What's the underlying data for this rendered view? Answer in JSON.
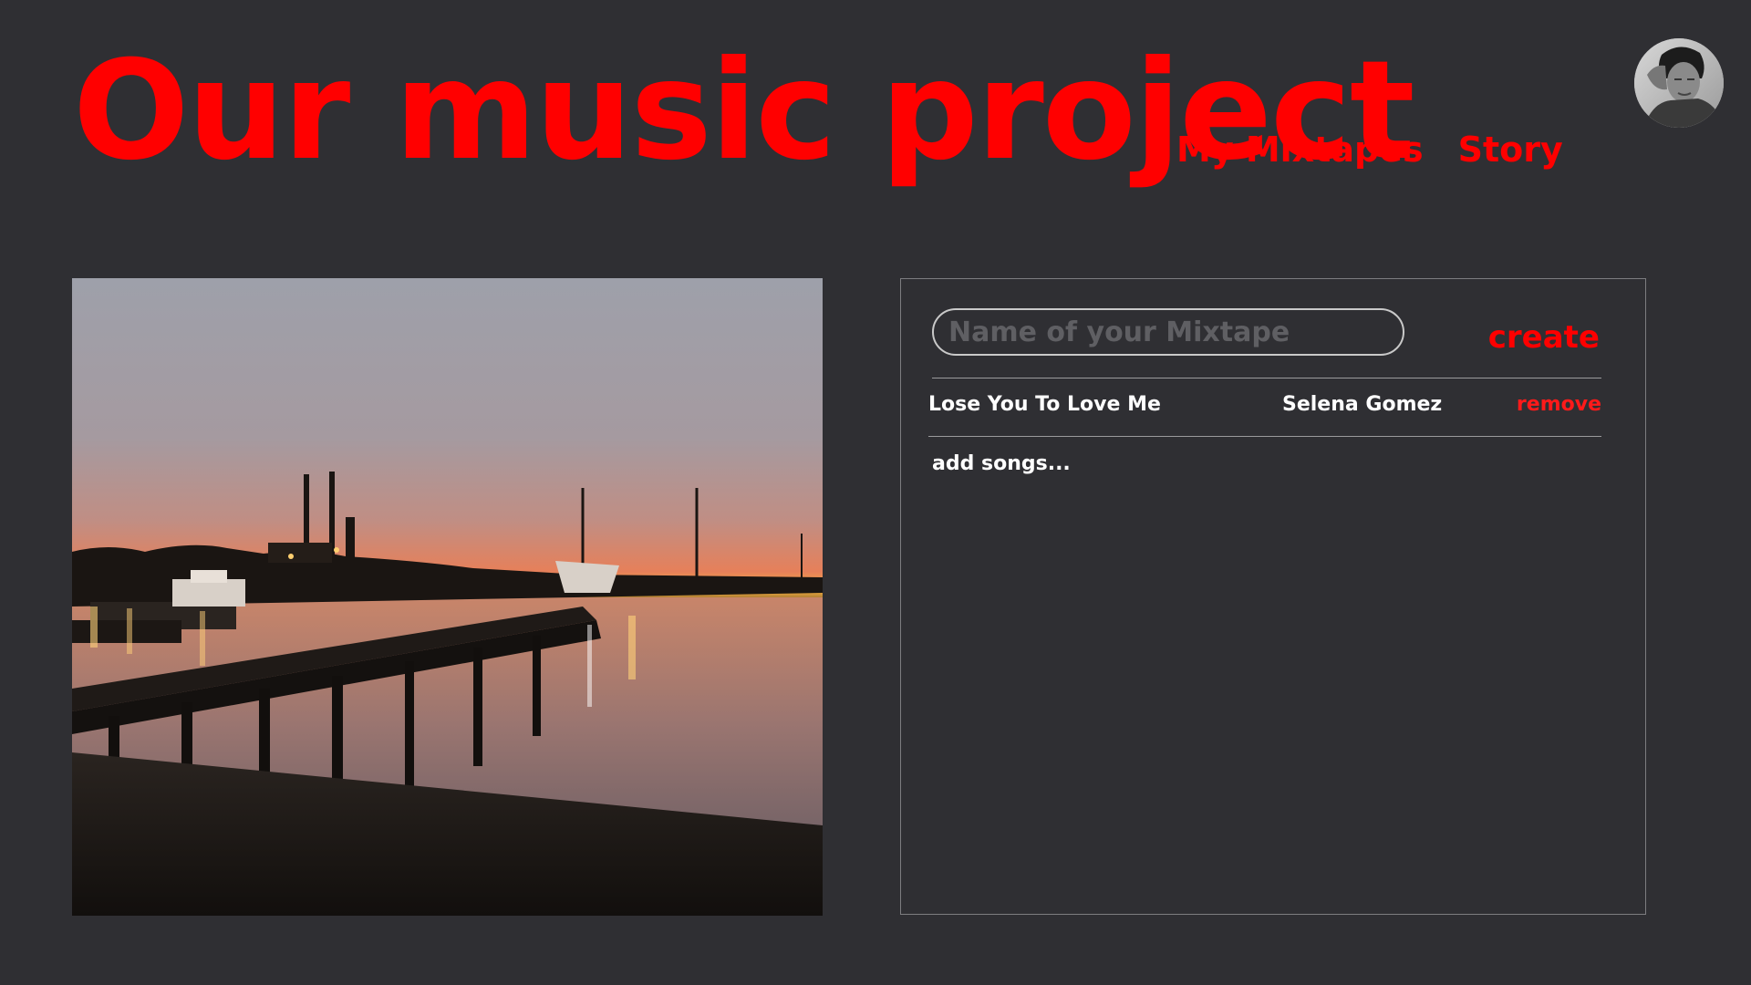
{
  "header": {
    "title": "Our music project",
    "nav": [
      {
        "label": "My Mixtapes"
      },
      {
        "label": "Story"
      }
    ]
  },
  "photo": {
    "alt": "Sunset over a harbor pier with boats and smokestacks"
  },
  "mixtape": {
    "name_placeholder": "Name of your Mixtape",
    "name_value": "",
    "create_label": "create",
    "songs": [
      {
        "title": "Lose You To Love Me",
        "artist": "Selena Gomez",
        "remove_label": "remove"
      }
    ],
    "add_songs_label": "add songs..."
  },
  "colors": {
    "background": "#2f2f33",
    "accent": "#ff0000",
    "text": "#ffffff"
  }
}
